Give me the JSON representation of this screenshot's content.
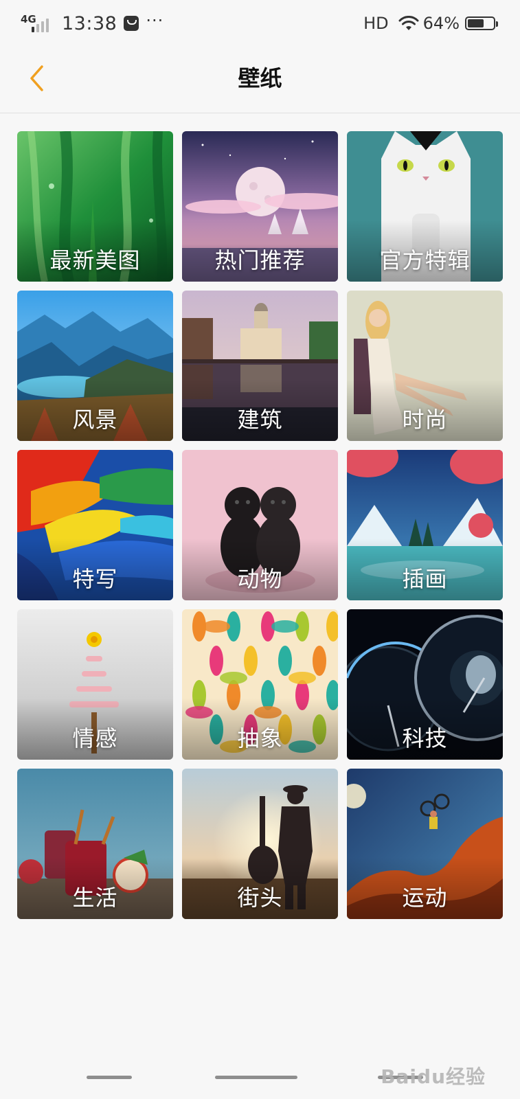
{
  "status_bar": {
    "network": "4G",
    "time": "13:38",
    "more": "···",
    "hd": "HD",
    "battery_percent": "64%",
    "battery_level": 0.64,
    "signal_bars": 1
  },
  "header": {
    "back_icon": "chevron-left-icon",
    "title": "壁纸",
    "accent_color": "#f0a020"
  },
  "categories": [
    {
      "label": "最新美图",
      "theme": "green-grass"
    },
    {
      "label": "热门推荐",
      "theme": "moon-night"
    },
    {
      "label": "官方特辑",
      "theme": "white-cat"
    },
    {
      "label": "风景",
      "theme": "mountain-lake"
    },
    {
      "label": "建筑",
      "theme": "building-reflection"
    },
    {
      "label": "时尚",
      "theme": "woman-chair"
    },
    {
      "label": "特写",
      "theme": "parrot-feathers"
    },
    {
      "label": "动物",
      "theme": "black-pugs"
    },
    {
      "label": "插画",
      "theme": "winter-illustration"
    },
    {
      "label": "情感",
      "theme": "candy-tree"
    },
    {
      "label": "抽象",
      "theme": "colorful-petals"
    },
    {
      "label": "科技",
      "theme": "speedometer"
    },
    {
      "label": "生活",
      "theme": "fruit-drinks"
    },
    {
      "label": "街头",
      "theme": "guitar-silhouette"
    },
    {
      "label": "运动",
      "theme": "bmx-desert"
    }
  ],
  "watermark": "Baidu经验"
}
